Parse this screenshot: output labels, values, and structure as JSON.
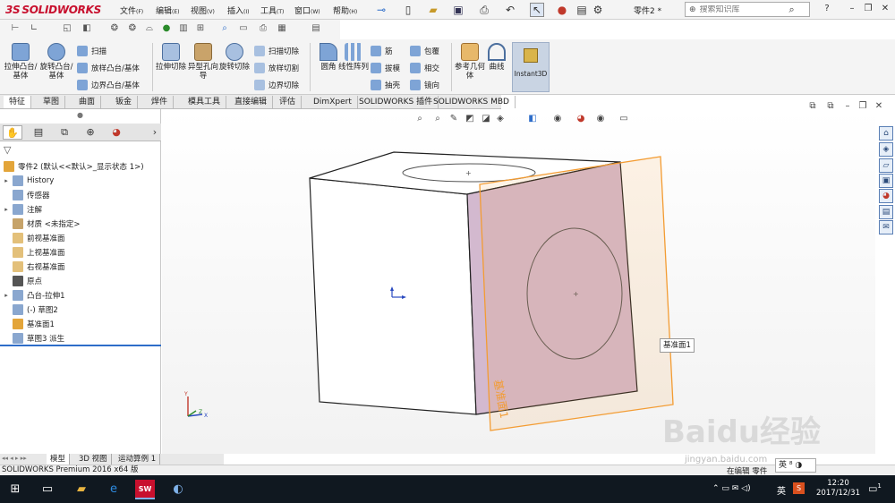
{
  "app": {
    "logo": "SOLIDWORKS",
    "logo_mark": "3S"
  },
  "menu": [
    {
      "label": "文件",
      "key": "(F)"
    },
    {
      "label": "编辑",
      "key": "(E)"
    },
    {
      "label": "视图",
      "key": "(V)"
    },
    {
      "label": "插入",
      "key": "(I)"
    },
    {
      "label": "工具",
      "key": "(T)"
    },
    {
      "label": "窗口",
      "key": "(W)"
    },
    {
      "label": "帮助",
      "key": "(H)"
    }
  ],
  "document": {
    "name": "零件2 *"
  },
  "search": {
    "placeholder": "搜索知识库"
  },
  "command_manager": {
    "extrude_boss": "拉伸凸台/基体",
    "revolve_boss": "旋转凸台/基体",
    "sweep": "扫描",
    "loft": "放样凸台/基体",
    "boundary_boss": "边界凸台/基体",
    "extrude_cut": "拉伸切除",
    "hole_wizard": "异型孔向导",
    "revolve_cut": "旋转切除",
    "swept_cut": "扫描切除",
    "lofted_cut": "放样切割",
    "boundary_cut": "边界切除",
    "fillet": "圆角",
    "linear_pattern": "线性阵列",
    "rib": "筋",
    "draft": "拔模",
    "shell": "抽壳",
    "wrap": "包覆",
    "intersect": "相交",
    "mirror": "镜向",
    "ref_geometry": "参考几何体",
    "curves": "曲线",
    "instant3d": "Instant3D"
  },
  "tabs": [
    "特征",
    "草图",
    "曲面",
    "钣金",
    "焊件",
    "模具工具",
    "直接编辑",
    "评估",
    "DimXpert",
    "SOLIDWORKS 插件",
    "SOLIDWORKS MBD"
  ],
  "tree": {
    "root": "零件2  (默认<<默认>_显示状态 1>)",
    "items": [
      {
        "label": "History",
        "exp": "▸"
      },
      {
        "label": "传感器",
        "exp": ""
      },
      {
        "label": "注解",
        "exp": "▸"
      },
      {
        "label": "材质 <未指定>",
        "exp": ""
      },
      {
        "label": "前视基准面",
        "exp": ""
      },
      {
        "label": "上视基准面",
        "exp": ""
      },
      {
        "label": "右视基准面",
        "exp": ""
      },
      {
        "label": "原点",
        "exp": ""
      },
      {
        "label": "凸台-拉伸1",
        "exp": "▸"
      },
      {
        "label": "(-) 草图2",
        "exp": ""
      },
      {
        "label": "基准面1",
        "exp": ""
      },
      {
        "label": "草图3 派生",
        "exp": ""
      }
    ]
  },
  "bottom_tabs": [
    "模型",
    "3D 视图",
    "运动算例 1"
  ],
  "status": {
    "text": "SOLIDWORKS Premium 2016 x64 版",
    "right": "在编辑 零件"
  },
  "graphics": {
    "plane_label": "基准面1",
    "tooltip": "基准面1"
  },
  "taskbar": {
    "ime": "英",
    "time": "12:20",
    "date": "2017/12/31",
    "notifications": "1"
  },
  "watermark": {
    "main": "Baidu经验",
    "sub": "jingyan.baidu.com"
  },
  "colors": {
    "accent": "#2e6dc9",
    "plane": "#f39c33",
    "face_highlight": "#d3b9cf"
  }
}
